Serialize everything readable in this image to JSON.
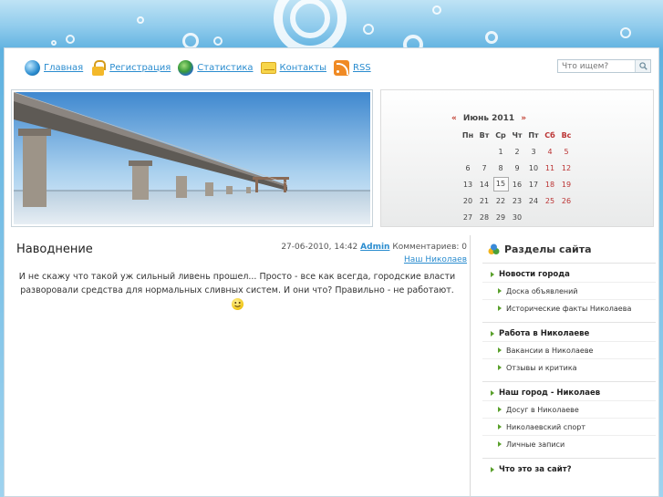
{
  "nav": {
    "items": [
      {
        "label": "Главная",
        "icon": "globe-icon"
      },
      {
        "label": "Регистрация",
        "icon": "lock-icon"
      },
      {
        "label": "Статистика",
        "icon": "earth-icon"
      },
      {
        "label": "Контакты",
        "icon": "mail-icon"
      },
      {
        "label": "RSS",
        "icon": "rss-icon"
      }
    ]
  },
  "search": {
    "placeholder": "Что ищем?"
  },
  "calendar": {
    "prev": "«",
    "month": "Июнь 2011",
    "next": "»",
    "weekdays": [
      "Пн",
      "Вт",
      "Ср",
      "Чт",
      "Пт",
      "Сб",
      "Вс"
    ],
    "weeks": [
      [
        "",
        "",
        "1",
        "2",
        "3",
        "4",
        "5"
      ],
      [
        "6",
        "7",
        "8",
        "9",
        "10",
        "11",
        "12"
      ],
      [
        "13",
        "14",
        "15",
        "16",
        "17",
        "18",
        "19"
      ],
      [
        "20",
        "21",
        "22",
        "23",
        "24",
        "25",
        "26"
      ],
      [
        "27",
        "28",
        "29",
        "30",
        "",
        "",
        ""
      ]
    ],
    "today": "15"
  },
  "post": {
    "title": "Наводнение",
    "date": "27-06-2010, 14:42",
    "author": "Admin",
    "comments": "Комментариев: 0",
    "category": "Наш Николаев",
    "body": "И не скажу что такой уж сильный ливень прошел... Просто - все как всегда, городские власти разворовали средства для нормальных сливных систем. И они что? Правильно - не работают."
  },
  "sidebar": {
    "title": "Разделы сайта",
    "groups": [
      {
        "label": "Новости города",
        "items": [
          "Доска объявлений",
          "Исторические факты Николаева"
        ]
      },
      {
        "label": "Работа в Николаеве",
        "items": [
          "Вакансии в Николаеве",
          "Отзывы и критика"
        ]
      },
      {
        "label": "Наш город - Николаев",
        "items": [
          "Досуг в Николаеве",
          "Николаевский спорт",
          "Личные записи"
        ]
      },
      {
        "label": "Что это за сайт?",
        "items": []
      }
    ]
  },
  "colors": {
    "accent": "#2a8ccf",
    "weekend": "#b33333",
    "bullet": "#5aa02c"
  }
}
